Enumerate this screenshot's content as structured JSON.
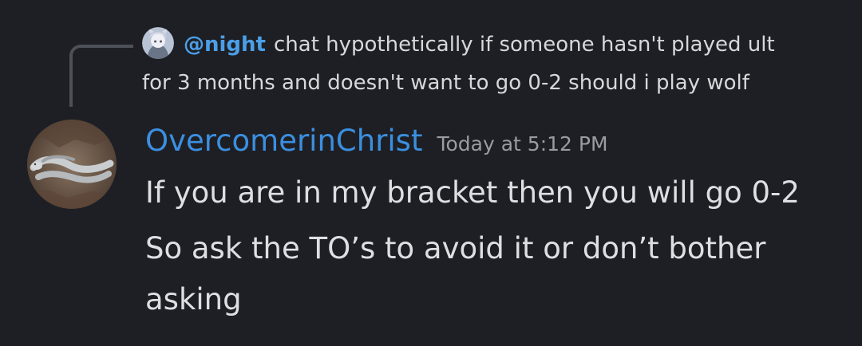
{
  "reply": {
    "author": "@night",
    "text_line1": "chat hypothetically if someone hasn't played ult",
    "text_line2": "for 3 months and doesn't want to go 0-2 should i play wolf"
  },
  "message": {
    "author": "OvercomerinChrist",
    "timestamp": "Today at 5:12 PM",
    "lines": [
      "If you are in my bracket then you will go 0-2",
      "So ask the TO’s to avoid it or don’t bother",
      "asking"
    ]
  },
  "colors": {
    "background": "#1e1f24",
    "author": "#3b8fe0",
    "reply_author": "#4a9fe8",
    "timestamp": "#9a9ca3",
    "text": "#dedfe3"
  },
  "icons": {
    "reply_avatar": "anime-avatar-icon",
    "author_avatar": "snake-photo-avatar"
  }
}
